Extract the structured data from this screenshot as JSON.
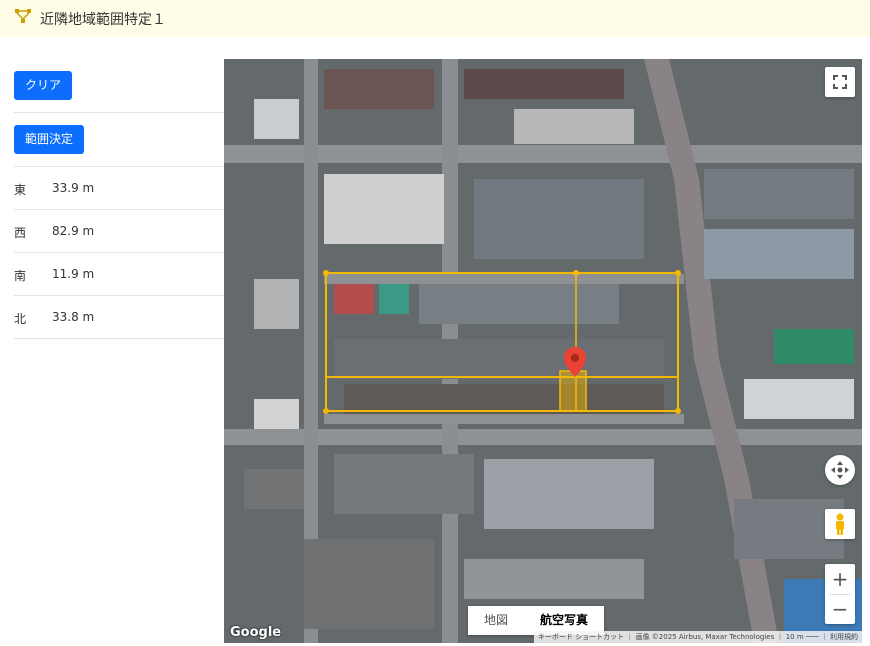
{
  "header": {
    "title": "近隣地域範囲特定１",
    "icon": "network-icon"
  },
  "sidebar": {
    "clear_label": "クリア",
    "decide_label": "範囲決定",
    "rows": [
      {
        "dir": "東",
        "value": "33.9 m"
      },
      {
        "dir": "西",
        "value": "82.9 m"
      },
      {
        "dir": "南",
        "value": "11.9 m"
      },
      {
        "dir": "北",
        "value": "33.8 m"
      }
    ]
  },
  "map": {
    "type_map_label": "地図",
    "type_satellite_label": "航空写真",
    "google_label": "Google",
    "attribution": "キーボード ショートカット ｜ 画像 ©2025 Airbus, Maxar Technologies ｜ 10 m ─── ｜ 利用規約",
    "zoom_in": "+",
    "zoom_out": "−",
    "accent": "#f5b800",
    "marker_color": "#ea4335"
  }
}
